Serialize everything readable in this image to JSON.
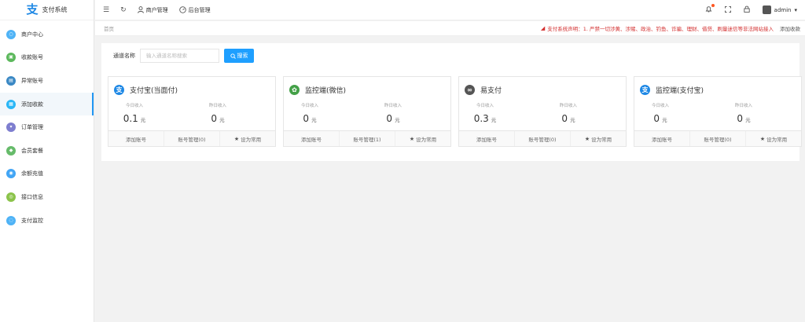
{
  "app": {
    "logo_glyph": "支",
    "title": "支付系统",
    "accent": "#1e9fff"
  },
  "sidebar": {
    "items": [
      {
        "label": "商户中心",
        "color": "#4fb3f6",
        "glyph": "○",
        "active": false
      },
      {
        "label": "收款账号",
        "color": "#5cb85c",
        "glyph": "▣",
        "active": false
      },
      {
        "label": "异常账号",
        "color": "#3a88c4",
        "glyph": "▤",
        "active": false
      },
      {
        "label": "添加收款",
        "color": "#29b6f6",
        "glyph": "▦",
        "active": true
      },
      {
        "label": "订单管理",
        "color": "#7e7ecf",
        "glyph": "▾",
        "active": false
      },
      {
        "label": "会员套餐",
        "color": "#66bb6a",
        "glyph": "◆",
        "active": false
      },
      {
        "label": "余额充值",
        "color": "#42a5f5",
        "glyph": "◉",
        "active": false
      },
      {
        "label": "接口信息",
        "color": "#8bc34a",
        "glyph": "◎",
        "active": false
      },
      {
        "label": "支付监控",
        "color": "#4fb3f6",
        "glyph": "◌",
        "active": false
      }
    ]
  },
  "topbar": {
    "menu_icon": "☰",
    "refresh_icon": "↻",
    "merchant_label": "商户管理",
    "backend_label": "后台管理",
    "user_name": "admin",
    "user_caret": "▾"
  },
  "breadcrumb": {
    "home": "首页",
    "notice": "支付系统声明：1. 严禁一切涉黄、涉赌、政治、钓鱼、诈骗、理财、借贷、刷量迷信等非法网站接入",
    "current_tab": "添加收款"
  },
  "search": {
    "label": "通道名称",
    "placeholder": "输入通道名称搜索",
    "button_label": "搜索"
  },
  "cards": [
    {
      "title": "支付宝(当面付)",
      "icon_color": "#1e88e5",
      "icon_glyph": "支",
      "today_label": "今日收入",
      "today_value": "0.1",
      "today_unit": "元",
      "yesterday_label": "昨日收入",
      "yesterday_value": "0",
      "yesterday_unit": "元",
      "add_label": "添加账号",
      "manage_label": "账号管理(0)",
      "fav_label": "设为常用"
    },
    {
      "title": "监控端(微信)",
      "icon_color": "#43a047",
      "icon_glyph": "✿",
      "today_label": "今日收入",
      "today_value": "0",
      "today_unit": "元",
      "yesterday_label": "昨日收入",
      "yesterday_value": "0",
      "yesterday_unit": "元",
      "add_label": "添加账号",
      "manage_label": "账号管理(1)",
      "fav_label": "设为常用"
    },
    {
      "title": "易支付",
      "icon_color": "#555555",
      "icon_glyph": "∞",
      "today_label": "今日收入",
      "today_value": "0.3",
      "today_unit": "元",
      "yesterday_label": "昨日收入",
      "yesterday_value": "0",
      "yesterday_unit": "元",
      "add_label": "添加账号",
      "manage_label": "账号管理(0)",
      "fav_label": "设为常用"
    },
    {
      "title": "监控端(支付宝)",
      "icon_color": "#1e88e5",
      "icon_glyph": "支",
      "today_label": "今日收入",
      "today_value": "0",
      "today_unit": "元",
      "yesterday_label": "昨日收入",
      "yesterday_value": "0",
      "yesterday_unit": "元",
      "add_label": "添加账号",
      "manage_label": "账号管理(0)",
      "fav_label": "设为常用"
    }
  ]
}
